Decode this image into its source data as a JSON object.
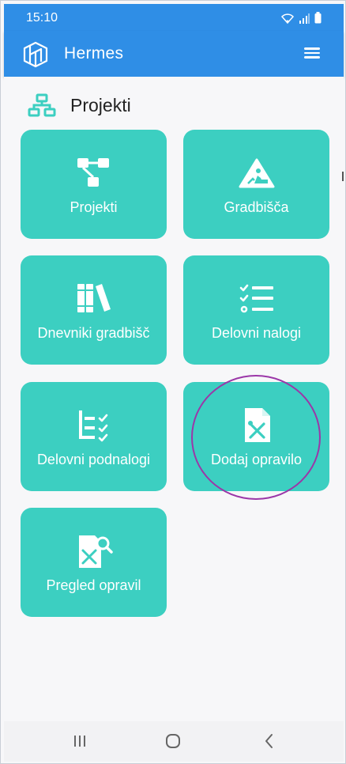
{
  "status_bar": {
    "time": "15:10"
  },
  "app_bar": {
    "title": "Hermes",
    "logo_icon": "hermes-cube-logo",
    "menu_icon": "hamburger-menu-icon"
  },
  "section": {
    "title": "Projekti",
    "icon": "sitemap-icon"
  },
  "tiles": [
    {
      "label": "Projekti",
      "icon": "project-tree-icon"
    },
    {
      "label": "Gradbišča",
      "icon": "construction-sign-icon"
    },
    {
      "label": "Dnevniki gradbišč",
      "icon": "books-icon"
    },
    {
      "label": "Delovni nalogi",
      "icon": "checklist-icon"
    },
    {
      "label": "Delovni podnalogi",
      "icon": "sub-checklist-icon"
    },
    {
      "label": "Dodaj opravilo",
      "icon": "file-tools-icon"
    },
    {
      "label": "Pregled opravil",
      "icon": "file-tools-search-icon"
    }
  ],
  "colors": {
    "app_bar": "#2f8ee6",
    "tile": "#3ccfc1",
    "highlight": "#9b37a8",
    "background": "#f7f7f9"
  }
}
